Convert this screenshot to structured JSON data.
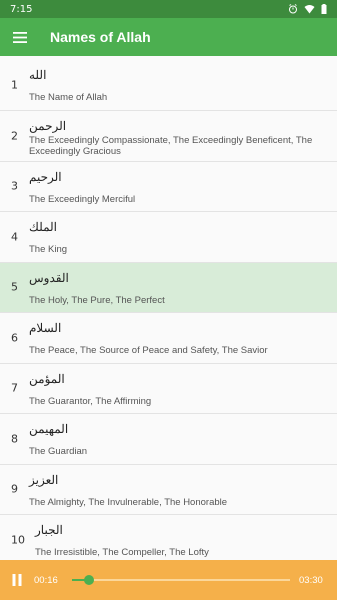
{
  "status_bar": {
    "time": "7:15",
    "icons": [
      "alarm-icon",
      "wifi-icon",
      "battery-icon"
    ]
  },
  "app_bar": {
    "title": "Names of Allah",
    "menu_icon": "hamburger-menu-icon"
  },
  "names": [
    {
      "number": "1",
      "arabic": "الله",
      "meaning": "The Name of Allah"
    },
    {
      "number": "2",
      "arabic": "الرحمن",
      "meaning": "The Exceedingly Compassionate, The Exceedingly Beneficent, The Exceedingly Gracious"
    },
    {
      "number": "3",
      "arabic": "الرحيم",
      "meaning": "The Exceedingly Merciful"
    },
    {
      "number": "4",
      "arabic": "الملك",
      "meaning": "The King"
    },
    {
      "number": "5",
      "arabic": "القدوس",
      "meaning": "The Holy, The Pure, The Perfect"
    },
    {
      "number": "6",
      "arabic": "السلام",
      "meaning": "The Peace, The Source of Peace and Safety, The Savior"
    },
    {
      "number": "7",
      "arabic": "المؤمن",
      "meaning": "The Guarantor, The Affirming"
    },
    {
      "number": "8",
      "arabic": "المهيمن",
      "meaning": "The Guardian"
    },
    {
      "number": "9",
      "arabic": "العزيز",
      "meaning": "The Almighty, The Invulnerable, The Honorable"
    },
    {
      "number": "10",
      "arabic": "الجبار",
      "meaning": "The Irresistible, The Compeller, The Lofty"
    }
  ],
  "selected_index": 4,
  "player": {
    "current_time": "00:16",
    "total_time": "03:30",
    "progress": 0.076,
    "state": "playing",
    "accent": "#4caf50",
    "background": "#f5b04a"
  },
  "colors": {
    "app_bar": "#4caf50",
    "status_bar": "#3d8b3d",
    "selected_row": "#d8ecd8"
  }
}
